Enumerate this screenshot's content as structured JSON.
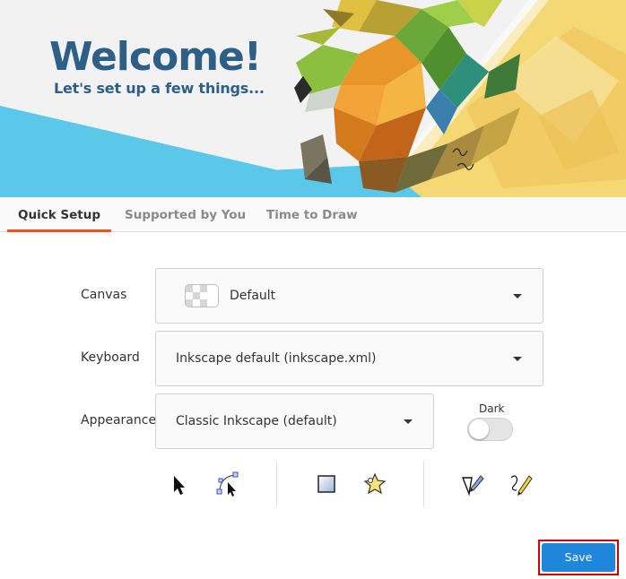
{
  "banner": {
    "title": "Welcome!",
    "subtitle": "Let's set up a few things..."
  },
  "tabs": [
    {
      "label": "Quick Setup",
      "active": true
    },
    {
      "label": "Supported by You",
      "active": false
    },
    {
      "label": "Time to Draw",
      "active": false
    }
  ],
  "form": {
    "canvas_label": "Canvas",
    "canvas_value": "Default",
    "keyboard_label": "Keyboard",
    "keyboard_value": "Inkscape default (inkscape.xml)",
    "appearance_label": "Appearance",
    "appearance_value": "Classic Inkscape (default)",
    "dark_label": "Dark",
    "dark_enabled": false
  },
  "tools": [
    "select-arrow-icon",
    "node-edit-icon",
    "rectangle-icon",
    "star-icon",
    "calligraphy-icon",
    "pencil-icon"
  ],
  "footer": {
    "save_label": "Save"
  },
  "colors": {
    "accent_tab": "#e95420",
    "save_button": "#1f86d9",
    "title_blue": "#2e5f86",
    "banner_cyan": "#5bc8ea",
    "banner_yellow": "#f4d874"
  }
}
